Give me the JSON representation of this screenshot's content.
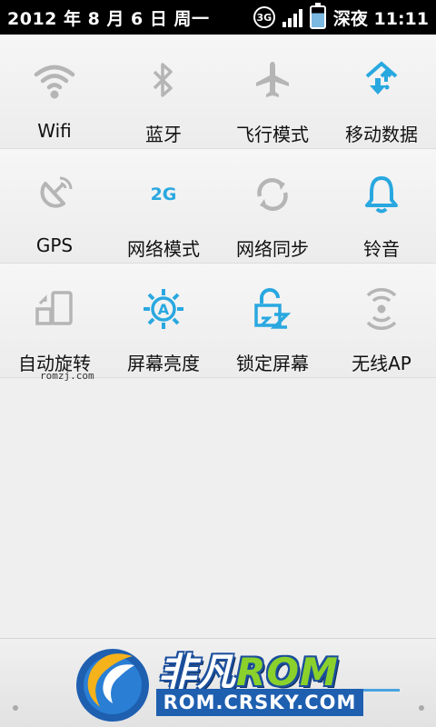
{
  "status_bar": {
    "date": "2012 年 8 月 6 日 周一",
    "network_type": "3G",
    "carrier": "深夜",
    "time": "11:11"
  },
  "tiles": [
    {
      "label": "Wifi",
      "icon": "wifi-icon",
      "active": false
    },
    {
      "label": "蓝牙",
      "icon": "bluetooth-icon",
      "active": false
    },
    {
      "label": "飞行模式",
      "icon": "airplane-icon",
      "active": false
    },
    {
      "label": "移动数据",
      "icon": "mobile-data-icon",
      "active": true
    },
    {
      "label": "GPS",
      "icon": "gps-icon",
      "active": false
    },
    {
      "label": "网络模式",
      "icon": "network-mode-2g-icon",
      "active": true,
      "icon_text": "2G"
    },
    {
      "label": "网络同步",
      "icon": "sync-icon",
      "active": false
    },
    {
      "label": "铃音",
      "icon": "bell-icon",
      "active": true
    },
    {
      "label": "自动旋转",
      "icon": "auto-rotate-icon",
      "active": false
    },
    {
      "label": "屏幕亮度",
      "icon": "brightness-icon",
      "active": true,
      "icon_text": "A"
    },
    {
      "label": "锁定屏幕",
      "icon": "lock-screen-icon",
      "active": true
    },
    {
      "label": "无线AP",
      "icon": "wireless-ap-icon",
      "active": false
    }
  ],
  "watermark_small": "romzj.com",
  "logo": {
    "name_cn": "非凡",
    "name_en": "ROM",
    "url": "ROM.CRSKY.COM"
  },
  "colors": {
    "active": "#29a8e0",
    "inactive": "#b5b5b5"
  }
}
